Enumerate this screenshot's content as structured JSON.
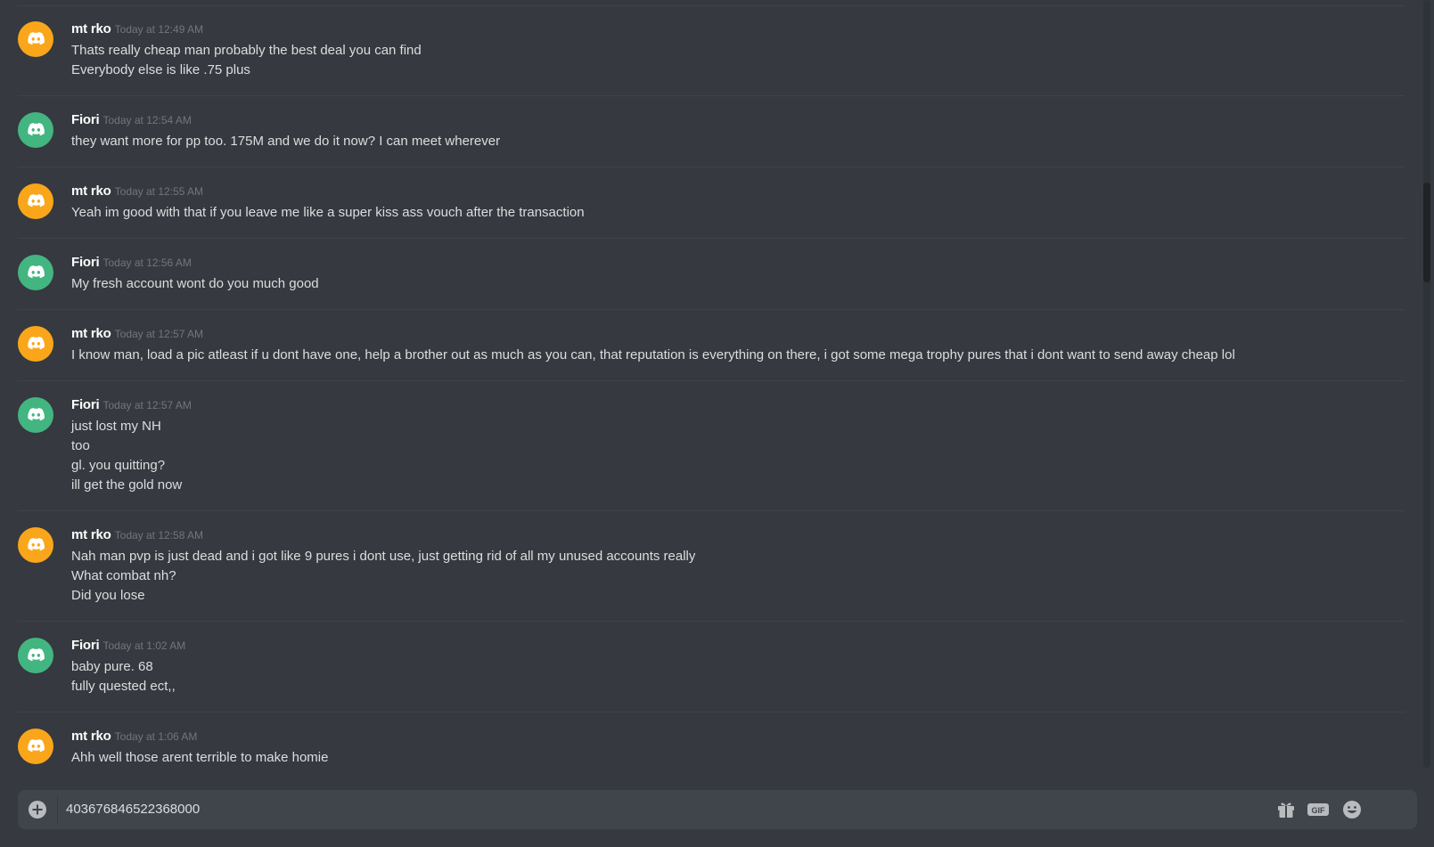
{
  "colors": {
    "background": "#36393f",
    "avatar_orange": "#faa61a",
    "avatar_green": "#43b581",
    "username": "#ffffff",
    "timestamp": "#72767d",
    "message_text": "#dcddde",
    "composer_bg": "#40444b"
  },
  "messages": [
    {
      "author": "mt rko",
      "avatar_color": "orange",
      "timestamp": "Today at 12:49 AM",
      "lines": [
        "Thats really cheap man probably the best deal you can find",
        "Everybody else is like .75 plus"
      ]
    },
    {
      "author": "Fiori",
      "avatar_color": "green",
      "timestamp": "Today at 12:54 AM",
      "lines": [
        "they want more for pp too. 175M and we do it now? I can meet wherever"
      ]
    },
    {
      "author": "mt rko",
      "avatar_color": "orange",
      "timestamp": "Today at 12:55 AM",
      "lines": [
        "Yeah im good with that if you leave me like a super kiss ass vouch after the transaction"
      ]
    },
    {
      "author": "Fiori",
      "avatar_color": "green",
      "timestamp": "Today at 12:56 AM",
      "lines": [
        "My fresh account wont do you much good"
      ]
    },
    {
      "author": "mt rko",
      "avatar_color": "orange",
      "timestamp": "Today at 12:57 AM",
      "lines": [
        "I know man, load a pic atleast if u dont have one, help a brother out as much as you can, that reputation is everything on there, i got some mega trophy pures that i dont want to send away cheap lol"
      ]
    },
    {
      "author": "Fiori",
      "avatar_color": "green",
      "timestamp": "Today at 12:57 AM",
      "lines": [
        "just lost my NH",
        "too",
        "gl. you quitting?",
        "ill get the gold now"
      ]
    },
    {
      "author": "mt rko",
      "avatar_color": "orange",
      "timestamp": "Today at 12:58 AM",
      "lines": [
        "Nah man pvp is just dead and i got like 9 pures i dont use, just getting rid of all my unused accounts really",
        "What combat nh?",
        "Did you lose"
      ]
    },
    {
      "author": "Fiori",
      "avatar_color": "green",
      "timestamp": "Today at 1:02 AM",
      "lines": [
        "baby pure. 68",
        "fully quested ect,,"
      ]
    },
    {
      "author": "mt rko",
      "avatar_color": "orange",
      "timestamp": "Today at 1:06 AM",
      "lines": [
        "Ahh well those arent terrible to make homie"
      ]
    }
  ],
  "composer": {
    "value": "403676846522368000",
    "attach_icon": "plus-circle-icon",
    "gift_icon": "gift-icon",
    "gif_label": "GIF",
    "emoji_icon": "emoji-icon"
  }
}
